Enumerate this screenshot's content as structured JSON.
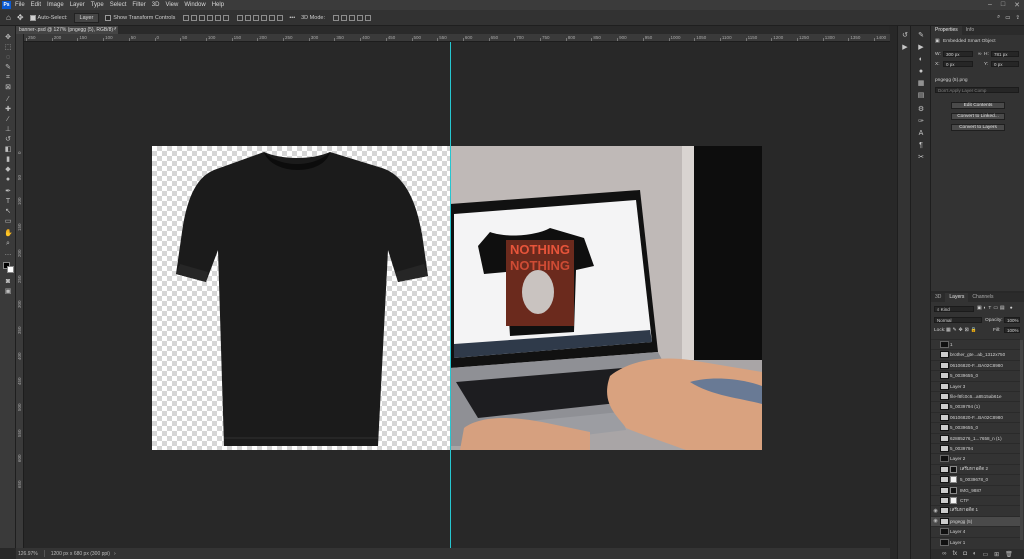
{
  "menu": {
    "logo": "Ps",
    "items": [
      "File",
      "Edit",
      "Image",
      "Layer",
      "Type",
      "Select",
      "Filter",
      "3D",
      "View",
      "Window",
      "Help"
    ],
    "window_controls": [
      "–",
      "□",
      "✕"
    ]
  },
  "options_bar": {
    "auto_select_label": "Auto-Select:",
    "auto_select_target": "Layer",
    "transform_controls_label": "Show Transform Controls",
    "mode_3d_label": "3D Mode:"
  },
  "document": {
    "tab_title": "banner-.psd @ 127% (pngegg (5), RGB/8) *",
    "close": "×"
  },
  "ruler": {
    "top_ticks": [
      "250",
      "200",
      "150",
      "100",
      "50",
      "0",
      "50",
      "100",
      "150",
      "200",
      "250",
      "300",
      "350",
      "400",
      "450",
      "500",
      "550",
      "600",
      "650",
      "700",
      "750",
      "800",
      "850",
      "900",
      "950",
      "1000",
      "1050",
      "1100",
      "1150",
      "1200",
      "1250",
      "1300",
      "1350",
      "1400"
    ],
    "left_ticks": [
      "0",
      "50",
      "100",
      "150",
      "200",
      "250",
      "300",
      "350",
      "400",
      "450",
      "500",
      "550",
      "600",
      "650"
    ]
  },
  "canvas": {
    "screen_title_line1": "NOTHING",
    "screen_title_line2": "NOTHING"
  },
  "status": {
    "zoom": "126.97%",
    "doc_info": "1200 px x 680 px (300 ppi)"
  },
  "properties": {
    "tabs": [
      "Properties",
      "Info"
    ],
    "kind": "Embedded Smart Object",
    "w_label": "W:",
    "w_value": "300 px",
    "h_label": "H:",
    "h_value": "781 px",
    "x_label": "X:",
    "x_value": "0 px",
    "y_label": "Y:",
    "y_value": "0 px",
    "filename": "pngegg (5).png",
    "comp_placeholder": "Don't Apply Layer Comp",
    "buttons": [
      "Edit Contents",
      "Convert to Linked...",
      "Convert to Layers"
    ]
  },
  "layers_panel": {
    "tabs": [
      "3D",
      "Layers",
      "Channels"
    ],
    "filter_kind": "Kind",
    "blend_mode": "Normal",
    "opacity_label": "Opacity:",
    "opacity_value": "100%",
    "lock_label": "Lock:",
    "fill_label": "Fill:",
    "fill_value": "100%",
    "layers": [
      {
        "name": "1"
      },
      {
        "name": "brother_gte...ab_1312x750"
      },
      {
        "name": "06106820-F...BA02C8980"
      },
      {
        "name": "5_0039655_0"
      },
      {
        "name": "Layer 3"
      },
      {
        "name": "file-f8fc0c6...a8515ab61e"
      },
      {
        "name": "5_0039794 (1)"
      },
      {
        "name": "06106820-F...BA02C8980"
      },
      {
        "name": "5_0039655_0"
      },
      {
        "name": "62885276_1...7658_n (1)"
      },
      {
        "name": "5_0039794"
      },
      {
        "name": "Layer 2"
      },
      {
        "name": "เสรีมหาอดีต 2"
      },
      {
        "name": "5_0039678_0"
      },
      {
        "name": "IMG_9887"
      },
      {
        "name": "CTF"
      },
      {
        "name": "เสรีมหาอดีต 1"
      },
      {
        "name": "pngegg (5)"
      },
      {
        "name": "Layer 4"
      },
      {
        "name": "Layer 1"
      }
    ]
  }
}
